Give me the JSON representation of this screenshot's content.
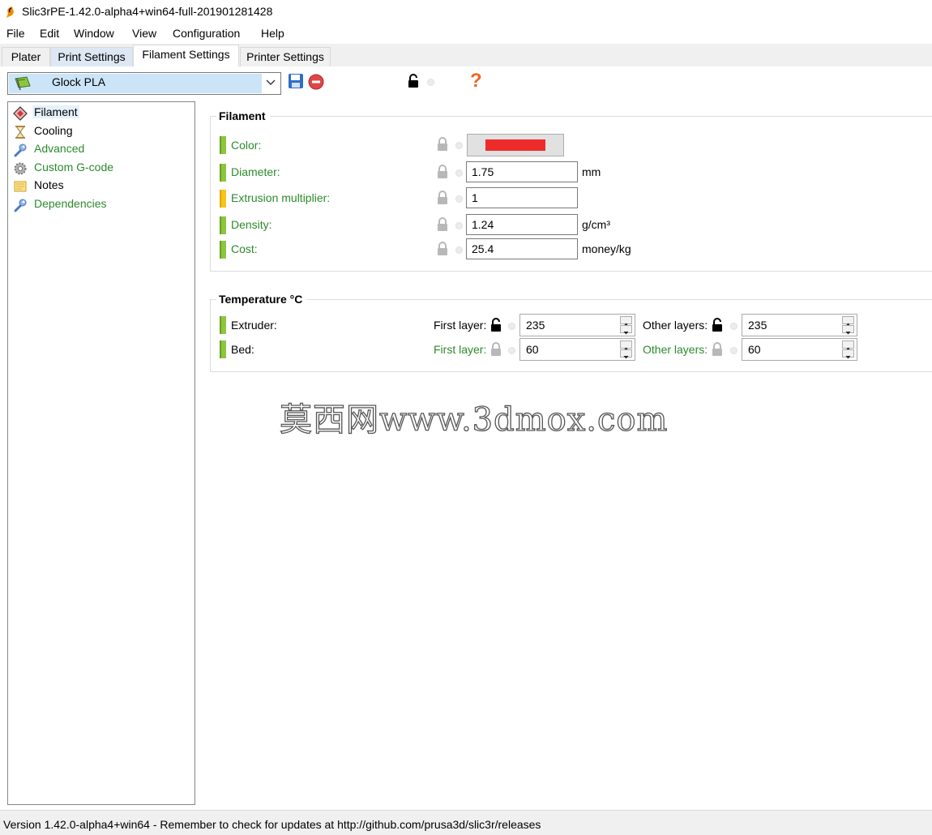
{
  "window": {
    "title": "Slic3rPE-1.42.0-alpha4+win64-full-201901281428"
  },
  "menu": [
    "File",
    "Edit",
    "Window",
    "View",
    "Configuration",
    "Help"
  ],
  "tabs": [
    "Plater",
    "Print Settings",
    "Filament Settings",
    "Printer Settings"
  ],
  "active_tab": "Filament Settings",
  "preset": {
    "name": "Glock PLA",
    "help_glyph": "?"
  },
  "tree": [
    {
      "label": "Filament",
      "icon": "spool-icon",
      "selected": true,
      "color": "#000000"
    },
    {
      "label": "Cooling",
      "icon": "hourglass-icon",
      "selected": false,
      "color": "#000000"
    },
    {
      "label": "Advanced",
      "icon": "wrench-icon",
      "selected": false,
      "color": "#2c8a2c"
    },
    {
      "label": "Custom G-code",
      "icon": "cog-icon",
      "selected": false,
      "color": "#2c8a2c"
    },
    {
      "label": "Notes",
      "icon": "note-icon",
      "selected": false,
      "color": "#000000"
    },
    {
      "label": "Dependencies",
      "icon": "wrench-icon",
      "selected": false,
      "color": "#2c8a2c"
    }
  ],
  "filament_group": {
    "title": "Filament",
    "color_label": "Color:",
    "color_value": "#ee2b2b",
    "diameter_label": "Diameter:",
    "diameter_value": "1.75",
    "diameter_unit": "mm",
    "extrusion_label": "Extrusion multiplier:",
    "extrusion_value": "1",
    "density_label": "Density:",
    "density_value": "1.24",
    "density_unit": "g/cm³",
    "cost_label": "Cost:",
    "cost_value": "25.4",
    "cost_unit": "money/kg"
  },
  "temperature_group": {
    "title": "Temperature °C",
    "extruder_label": "Extruder:",
    "bed_label": "Bed:",
    "first_layer_label": "First layer:",
    "other_layers_label": "Other layers:",
    "extruder_first": "235",
    "extruder_other": "235",
    "bed_first": "60",
    "bed_other": "60"
  },
  "status": "Version 1.42.0-alpha4+win64 - Remember to check for updates at http://github.com/prusa3d/slic3r/releases",
  "watermark": "莫西网www.3dmox.com"
}
